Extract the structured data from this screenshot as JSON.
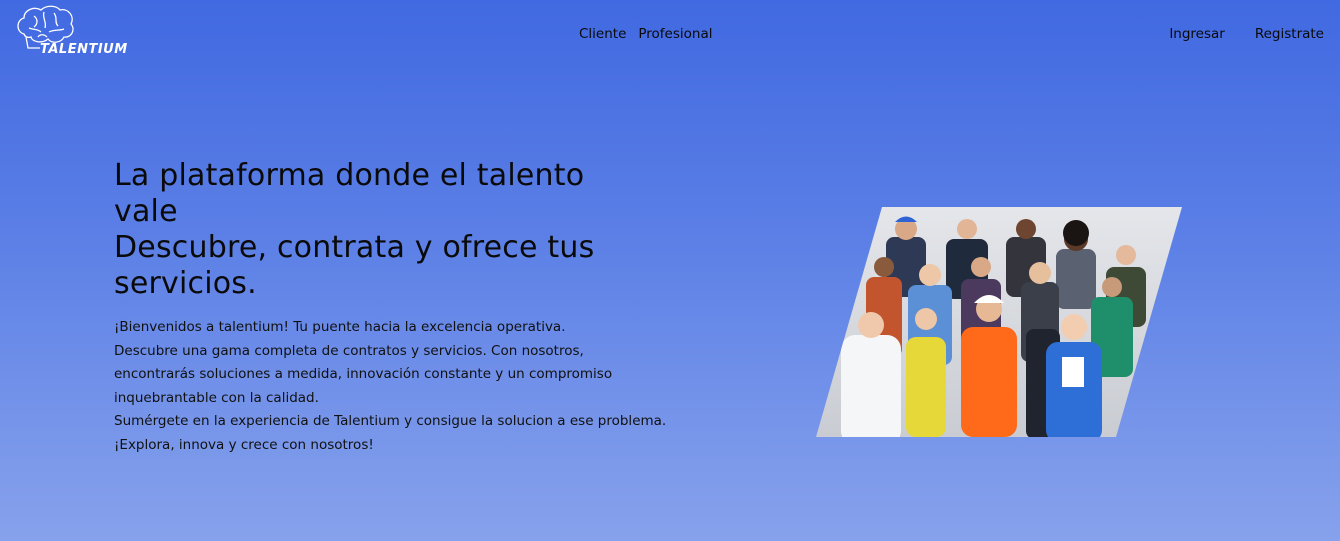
{
  "header": {
    "logo_text": "TALENTIUM",
    "nav_center": [
      "Cliente",
      "Profesional"
    ],
    "nav_right": [
      "Ingresar",
      "Registrate"
    ]
  },
  "hero": {
    "title_lines": [
      "La plataforma donde el talento",
      "vale",
      "Descubre, contrata y ofrece tus",
      "servicios."
    ],
    "paragraph_lines": [
      "¡Bienvenidos a talentium! Tu puente hacia la excelencia operativa.",
      "Descubre una gama completa de contratos y servicios. Con nosotros,",
      "encontrarás soluciones a medida, innovación constante y un compromiso",
      "inquebrantable con la calidad.",
      "Sumérgete en la experiencia de Talentium y consigue la solucion a ese problema.",
      "¡Explora, innova y crece con nosotros!"
    ],
    "image_icon": "group-of-professionals-photo"
  },
  "colors": {
    "background_top": "#4169e1",
    "background_bottom": "#87a2ec",
    "text": "#0a0a0a",
    "logo": "#ffffff"
  }
}
